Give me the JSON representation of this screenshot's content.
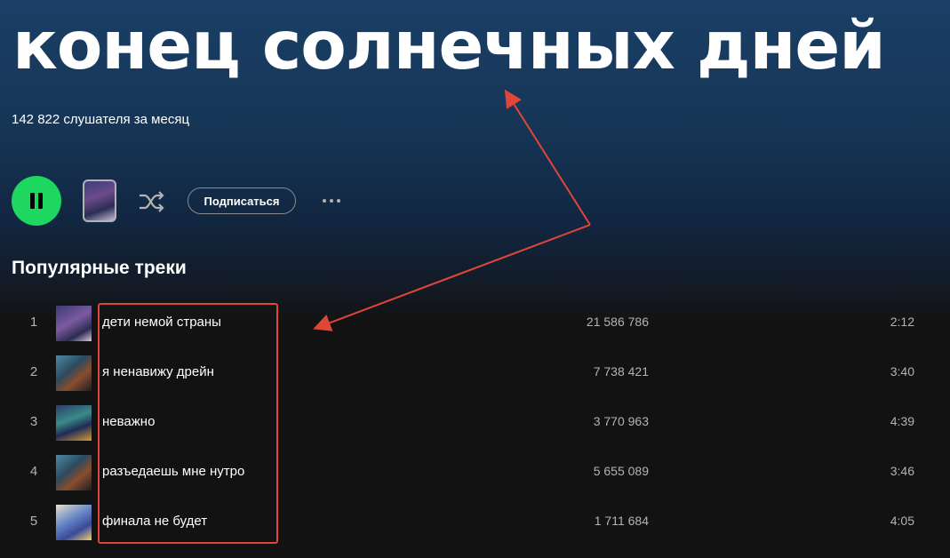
{
  "artist": {
    "name": "конец солнечных дней",
    "monthly_listeners": "142 822 слушателя за месяц"
  },
  "controls": {
    "play_icon": "pause-icon",
    "shuffle_icon": "shuffle-icon",
    "follow_label": "Подписаться",
    "more_icon": "more-options-icon"
  },
  "popular": {
    "title": "Популярные треки",
    "tracks": [
      {
        "num": "1",
        "title": "дети немой страны",
        "plays": "21 586 786",
        "duration": "2:12"
      },
      {
        "num": "2",
        "title": "я ненавижу дрейн",
        "plays": "7 738 421",
        "duration": "3:40"
      },
      {
        "num": "3",
        "title": "неважно",
        "plays": "3 770 963",
        "duration": "4:39"
      },
      {
        "num": "4",
        "title": "разъедаешь мне нутро",
        "plays": "5 655 089",
        "duration": "3:46"
      },
      {
        "num": "5",
        "title": "финала не будет",
        "plays": "1 711 684",
        "duration": "4:05"
      }
    ]
  },
  "colors": {
    "accent_green": "#1ed760",
    "annotation_red": "#e0453a",
    "header_blue": "#1a3f66",
    "background": "#121212"
  }
}
